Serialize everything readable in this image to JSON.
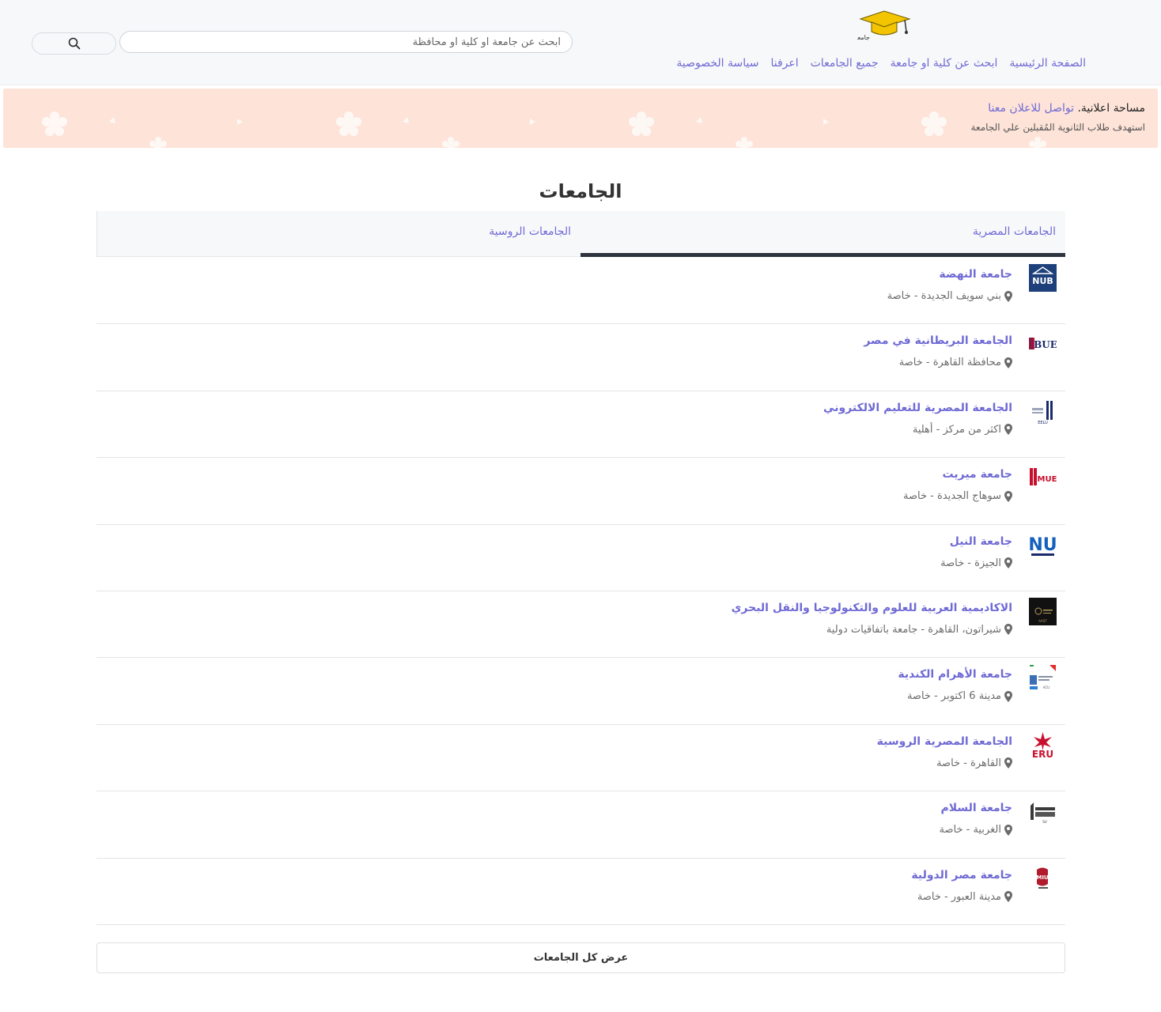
{
  "header": {
    "logo_text": "جامعة",
    "nav": [
      "الصفحة الرئيسية",
      "ابحث عن كلية او جامعة",
      "جميع الجامعات",
      "اعرفنا",
      "سياسة الخصوصية"
    ],
    "search": {
      "placeholder": "ابحث عن جامعة او كلية او محافظة",
      "value": ""
    },
    "search_button_icon": "search-icon"
  },
  "ad": {
    "label": "مساحة اعلانية.",
    "link": "تواصل للاعلان معنا",
    "subtitle": "استهدف طلاب الثانوية المُقبلين علي الجامعة",
    "background": "#fde3d8"
  },
  "main": {
    "title": "الجامعات",
    "tabs": [
      "الجامعات المصرية",
      "الجامعات الروسية"
    ],
    "active_tab": 0,
    "universities": [
      {
        "name": "جامعة النهضة",
        "location": "بني سويف الجديدة - خاصة",
        "logo": "NUB"
      },
      {
        "name": "الجامعة البريطانية في مصر",
        "location": "محافظة القاهرة - خاصة",
        "logo": "BUE"
      },
      {
        "name": "الجامعة المصرية للتعليم الالكتروني",
        "location": "اكثر من مركز - أهلية",
        "logo": "EELU"
      },
      {
        "name": "جامعة ميريت",
        "location": "سوهاج الجديدة - خاصة",
        "logo": "MUE"
      },
      {
        "name": "جامعة النيل",
        "location": "الجيزة - خاصة",
        "logo": "NU"
      },
      {
        "name": "الاكاديمية العربية للعلوم والتكنولوجيا والنقل البحري",
        "location": "شيراتون، القاهرة - جامعة باتفاقيات دولية",
        "logo": "AAST"
      },
      {
        "name": "جامعة الأهرام الكندية",
        "location": "مدينة 6 اكتوبر - خاصة",
        "logo": "ACU"
      },
      {
        "name": "الجامعة المصرية الروسية",
        "location": "القاهرة - خاصة",
        "logo": "ERU"
      },
      {
        "name": "جامعة السلام",
        "location": "الغربية - خاصة",
        "logo": "SU"
      },
      {
        "name": "جامعة مصر الدولية",
        "location": "مدينة العبور - خاصة",
        "logo": "MIU"
      }
    ],
    "view_all_label": "عرض كل الجامعات"
  },
  "colors": {
    "link": "#6f6ad4",
    "active_tab_underline": "#2e3340",
    "header_bg": "#f7f8fa"
  }
}
